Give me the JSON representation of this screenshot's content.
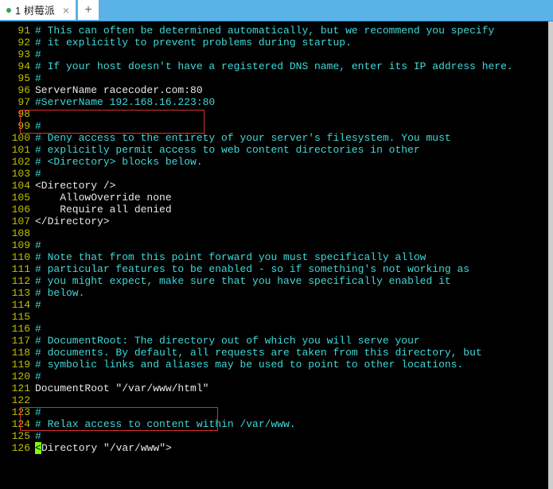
{
  "tabs": {
    "active": {
      "label": "1 树莓派",
      "status": "connected"
    },
    "add_label": "+"
  },
  "editor": {
    "lines": [
      {
        "n": 91,
        "t": "# This can often be determined automatically, but we recommend you specify",
        "c": "comment"
      },
      {
        "n": 92,
        "t": "# it explicitly to prevent problems during startup.",
        "c": "comment"
      },
      {
        "n": 93,
        "t": "#",
        "c": "comment"
      },
      {
        "n": 94,
        "t": "# If your host doesn't have a registered DNS name, enter its IP address here.",
        "c": "comment"
      },
      {
        "n": 95,
        "t": "#",
        "c": "comment"
      },
      {
        "n": 96,
        "t": "ServerName racecoder.com:80",
        "c": "directive"
      },
      {
        "n": 97,
        "t": "#ServerName 192.168.16.223:80",
        "c": "comment"
      },
      {
        "n": 98,
        "t": "",
        "c": "blank"
      },
      {
        "n": 99,
        "t": "#",
        "c": "comment"
      },
      {
        "n": 100,
        "t": "# Deny access to the entirety of your server's filesystem. You must",
        "c": "comment"
      },
      {
        "n": 101,
        "t": "# explicitly permit access to web content directories in other",
        "c": "comment"
      },
      {
        "n": 102,
        "t": "# <Directory> blocks below.",
        "c": "comment"
      },
      {
        "n": 103,
        "t": "#",
        "c": "comment"
      },
      {
        "n": 104,
        "t": "<Directory />",
        "c": "directive"
      },
      {
        "n": 105,
        "t": "    AllowOverride none",
        "c": "directive"
      },
      {
        "n": 106,
        "t": "    Require all denied",
        "c": "directive"
      },
      {
        "n": 107,
        "t": "</Directory>",
        "c": "directive"
      },
      {
        "n": 108,
        "t": "",
        "c": "blank"
      },
      {
        "n": 109,
        "t": "#",
        "c": "comment"
      },
      {
        "n": 110,
        "t": "# Note that from this point forward you must specifically allow",
        "c": "comment"
      },
      {
        "n": 111,
        "t": "# particular features to be enabled - so if something's not working as",
        "c": "comment"
      },
      {
        "n": 112,
        "t": "# you might expect, make sure that you have specifically enabled it",
        "c": "comment"
      },
      {
        "n": 113,
        "t": "# below.",
        "c": "comment"
      },
      {
        "n": 114,
        "t": "#",
        "c": "comment"
      },
      {
        "n": 115,
        "t": "",
        "c": "blank"
      },
      {
        "n": 116,
        "t": "#",
        "c": "comment"
      },
      {
        "n": 117,
        "t": "# DocumentRoot: The directory out of which you will serve your",
        "c": "comment"
      },
      {
        "n": 118,
        "t": "# documents. By default, all requests are taken from this directory, but",
        "c": "comment"
      },
      {
        "n": 119,
        "t": "# symbolic links and aliases may be used to point to other locations.",
        "c": "comment"
      },
      {
        "n": 120,
        "t": "#",
        "c": "comment"
      },
      {
        "n": 121,
        "t": "DocumentRoot \"/var/www/html\"",
        "c": "directive"
      },
      {
        "n": 122,
        "t": "",
        "c": "blank"
      },
      {
        "n": 123,
        "t": "#",
        "c": "comment"
      },
      {
        "n": 124,
        "t": "# Relax access to content within /var/www.",
        "c": "comment"
      },
      {
        "n": 125,
        "t": "#",
        "c": "comment"
      },
      {
        "n": 126,
        "t": "<Directory \"/var/www\">",
        "c": "directive",
        "cursor_col": 0
      }
    ],
    "highlighted_lines": [
      96,
      97,
      121,
      122
    ],
    "colors": {
      "comment": "#40d8d8",
      "directive": "#e8e8e8",
      "gutter": "#c0c000",
      "cursor_bg": "#7fff00",
      "highlight_border": "#d93030",
      "tabbar_bg": "#5ab2e6"
    }
  }
}
